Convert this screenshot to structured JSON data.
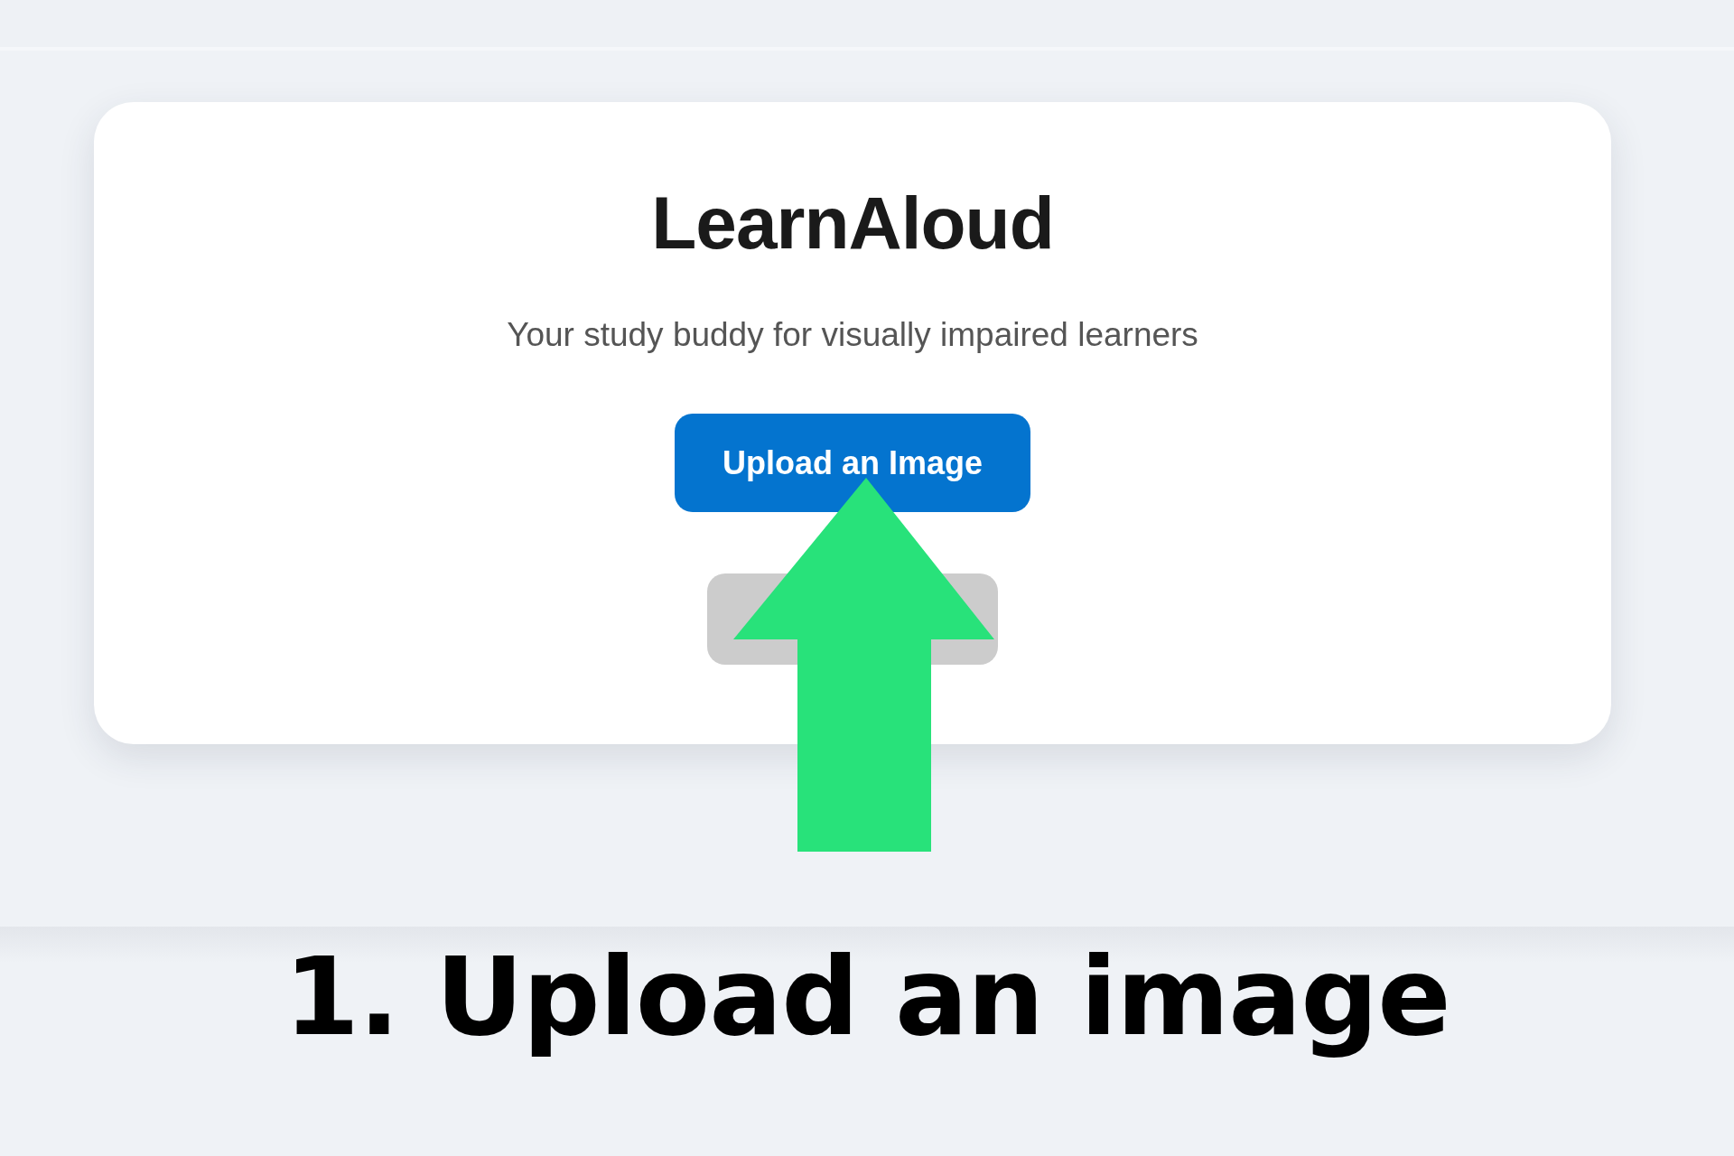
{
  "card": {
    "title": "LearnAloud",
    "subtitle": "Your study buddy for visually impaired learners",
    "upload_button": {
      "label": "Upload an Image"
    },
    "second_button": {
      "disabled": true
    }
  },
  "caption": "1. Upload an image"
}
